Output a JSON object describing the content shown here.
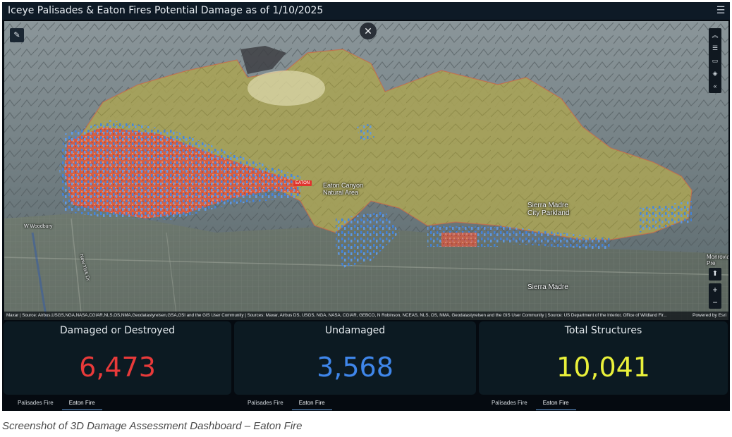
{
  "header": {
    "title": "Iceye Palisades & Eaton Fires Potential Damage as of 1/10/2025",
    "menu_icon": "hamburger-icon"
  },
  "map": {
    "labels": {
      "eaton": "EATON",
      "canyon": "Eaton Canyon\nNatural Area",
      "sierra_madre_park": "Sierra Madre\nCity Parkland",
      "sierra_madre": "Sierra Madre",
      "monrovia": "Monrovia\nPre",
      "woodbury": "W Woodbury",
      "new_york": "New York Dr"
    },
    "controls": {
      "close": "✕",
      "edit": "✎",
      "compass": "⬆",
      "zoom_in": "+",
      "zoom_out": "−"
    },
    "attribution": "Maxar | Source: Airbus,USGS,NGA,NASA,CGIAR,NLS,OS,NMA,Geodatastyrelsen,GSA,GSI and the GIS User Community | Sources: Maxar, Airbus DS, USGS, NGA, NASA, CGIAR, GEBCO, N Robinson, NCEAS, NLS, OS, NMA, Geodatastyrelsen and the GIS User Community | Source: US Department of the Interior, Office of Wildland Fir...",
    "powered_by": "Powered by Esri",
    "colors": {
      "burn_area": "#a8a358",
      "damaged": "#e4533f",
      "undamaged": "#3c86e8"
    }
  },
  "panels": [
    {
      "title": "Damaged or Destroyed",
      "value": "6,473",
      "color": "#e83a3a"
    },
    {
      "title": "Undamaged",
      "value": "3,568",
      "color": "#3f86ea"
    },
    {
      "title": "Total Structures",
      "value": "10,041",
      "color": "#e9f03a"
    }
  ],
  "tabs": {
    "palisades": "Palisades Fire",
    "eaton": "Eaton Fire"
  },
  "caption": "Screenshot of 3D Damage Assessment Dashboard – Eaton Fire"
}
